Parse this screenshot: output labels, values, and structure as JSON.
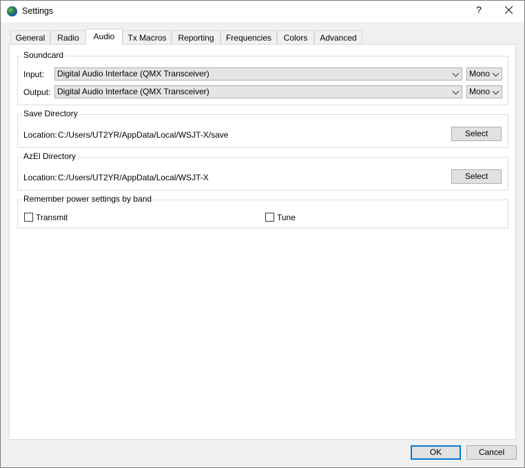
{
  "window": {
    "title": "Settings",
    "help_label": "?"
  },
  "tabs": [
    {
      "label": "General",
      "active": false
    },
    {
      "label": "Radio",
      "active": false
    },
    {
      "label": "Audio",
      "active": true
    },
    {
      "label": "Tx Macros",
      "active": false
    },
    {
      "label": "Reporting",
      "active": false
    },
    {
      "label": "Frequencies",
      "active": false
    },
    {
      "label": "Colors",
      "active": false
    },
    {
      "label": "Advanced",
      "active": false
    }
  ],
  "soundcard": {
    "title": "Soundcard",
    "input_label": "Input:",
    "input_device": "Digital Audio Interface (QMX Transceiver)",
    "input_channel": "Mono",
    "output_label": "Output:",
    "output_device": "Digital Audio Interface (QMX Transceiver)",
    "output_channel": "Mono"
  },
  "save_directory": {
    "title": "Save Directory",
    "location_label": "Location:",
    "path": "C:/Users/UT2YR/AppData/Local/WSJT-X/save",
    "select_label": "Select"
  },
  "azel_directory": {
    "title": "AzEl Directory",
    "location_label": "Location:",
    "path": "C:/Users/UT2YR/AppData/Local/WSJT-X",
    "select_label": "Select"
  },
  "power_settings": {
    "title": "Remember power settings by band",
    "transmit_label": "Transmit",
    "transmit_checked": false,
    "tune_label": "Tune",
    "tune_checked": false
  },
  "buttons": {
    "ok_label": "OK",
    "cancel_label": "Cancel"
  },
  "colors": {
    "accent": "#0078d7",
    "panel": "#ffffff",
    "background": "#f0f0f0"
  }
}
